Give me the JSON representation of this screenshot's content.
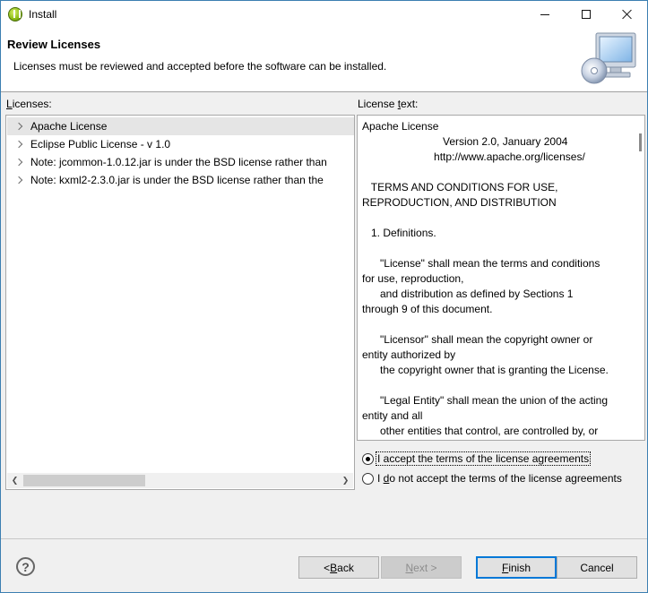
{
  "window": {
    "title": "Install"
  },
  "header": {
    "title": "Review Licenses",
    "description": "Licenses must be reviewed and accepted before the software can be installed."
  },
  "licenses": {
    "label_mnemonic": "L",
    "label_rest": "icenses:",
    "items": [
      {
        "label": "Apache License",
        "selected": true
      },
      {
        "label": "Eclipse Public License - v 1.0",
        "selected": false
      },
      {
        "label": "Note:  jcommon-1.0.12.jar is under the BSD license rather than",
        "selected": false
      },
      {
        "label": "Note:  kxml2-2.3.0.jar is under the BSD license rather than the",
        "selected": false
      }
    ]
  },
  "license_text": {
    "label_before": "License ",
    "label_mnemonic": "t",
    "label_after": "ext:",
    "content": "Apache License\n                           Version 2.0, January 2004\n                        http://www.apache.org/licenses/\n\n   TERMS AND CONDITIONS FOR USE,\nREPRODUCTION, AND DISTRIBUTION\n\n   1. Definitions.\n\n      \"License\" shall mean the terms and conditions\nfor use, reproduction,\n      and distribution as defined by Sections 1\nthrough 9 of this document.\n\n      \"Licensor\" shall mean the copyright owner or\nentity authorized by\n      the copyright owner that is granting the License.\n\n      \"Legal Entity\" shall mean the union of the acting\nentity and all\n      other entities that control, are controlled by, or"
  },
  "agreement": {
    "accept_label": "I accept the terms of the license agreements",
    "reject_before": "I ",
    "reject_mnemonic": "d",
    "reject_after": "o not accept the terms of the license agreements",
    "selected": "accept"
  },
  "buttons": {
    "back_prefix": "< ",
    "back_mnemonic": "B",
    "back_rest": "ack",
    "next_mnemonic": "N",
    "next_rest": "ext >",
    "finish_mnemonic": "F",
    "finish_rest": "inish",
    "cancel": "Cancel"
  },
  "icons": {
    "app": "eclipse-icon",
    "wizard": "install-computer-icon",
    "help": "help-icon"
  }
}
